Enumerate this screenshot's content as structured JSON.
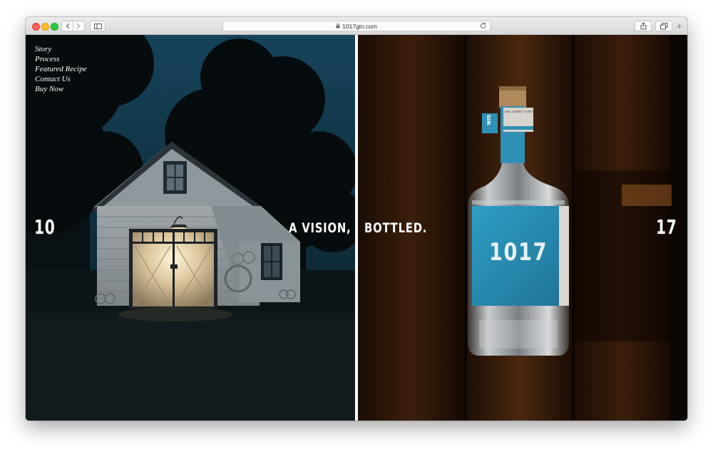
{
  "browser": {
    "url": "1017gin.com",
    "newtab_label": "+"
  },
  "nav": {
    "items": [
      "Story",
      "Process",
      "Featured Recipe",
      "Contact Us",
      "Buy Now"
    ]
  },
  "hero": {
    "left_number": "10",
    "right_number": "17",
    "tagline_left": "A VISION,",
    "tagline_right": "BOTTLED.",
    "bottle_label": "1017",
    "bottle_neck_text": "THE THIRTY ONE ...",
    "bottle_side_text": "GIN"
  },
  "colors": {
    "sky": "#123949",
    "label_blue": "#2a8fb5",
    "wood": "#3a1d0a"
  }
}
